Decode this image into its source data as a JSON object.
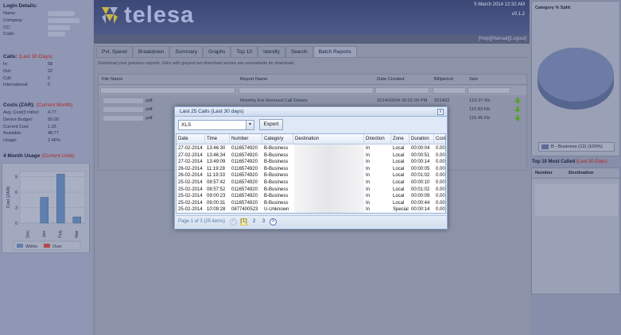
{
  "header": {
    "logo_text": "telesa",
    "date": "5 March 2014 12:32 AM",
    "version": "v0.1.2",
    "help_link": "[Help]",
    "manual_link": "[Manual]",
    "logout_link": "[Logout]"
  },
  "login": {
    "title": "Login Details:",
    "rows": [
      {
        "label": "Name:"
      },
      {
        "label": "Company:"
      },
      {
        "label": "CC:"
      },
      {
        "label": "Code:"
      }
    ]
  },
  "calls": {
    "title": "Calls:",
    "period": "(Last 30 Days)",
    "rows": [
      {
        "label": "In:",
        "value": "58"
      },
      {
        "label": "Out:",
        "value": "22"
      },
      {
        "label": "Coll:",
        "value": "0"
      },
      {
        "label": "International:",
        "value": "0"
      }
    ]
  },
  "costs": {
    "title": "Costs (ZAR):",
    "period": "(Current Month)",
    "rows": [
      {
        "label": "Avg. Cost(3 mths):",
        "value": "4.77"
      },
      {
        "label": "Device Budget:",
        "value": "50.00"
      },
      {
        "label": "Current Cost:",
        "value": "1.23"
      },
      {
        "label": "Available:",
        "value": "48.77"
      },
      {
        "label": "Usage:",
        "value": "2.46%"
      }
    ]
  },
  "usage_chart": {
    "title": "4 Month Usage",
    "title_note": "(Current Limit)",
    "legend_within": "Within",
    "legend_over": "Over",
    "colors": {
      "within": "#5f7fae",
      "over": "#b54a4a"
    }
  },
  "chart_data": {
    "type": "bar",
    "categories": [
      "Dec",
      "Jan",
      "Feb",
      "Mar"
    ],
    "values": [
      0,
      5,
      9.5,
      1.2
    ],
    "ylabel": "Cost (ZAR)",
    "yticks": [
      0,
      3,
      6,
      9
    ],
    "ylim": [
      0,
      10
    ],
    "legend": [
      "Within",
      "Over"
    ]
  },
  "tabs": [
    {
      "label": "Pvt. Spend"
    },
    {
      "label": "Breakdown"
    },
    {
      "label": "Summary"
    },
    {
      "label": "Graphs"
    },
    {
      "label": "Top 10"
    },
    {
      "label": "Identify"
    },
    {
      "label": "Search"
    },
    {
      "label": "Batch Reports",
      "active": true
    }
  ],
  "batch": {
    "hint": "Download your previous reports. Files with greyed out download arrows are unavailable for download.",
    "columns": [
      "File Name",
      "Report Name",
      "Date Created",
      "Billperiod",
      "Size"
    ],
    "rows": [
      {
        "file": ".pdf",
        "report": "Monthly Ext Itemised Call Details",
        "date": "2014/03/04 05:02:00 PM",
        "billperiod": "201402",
        "size": "123.37 Kb"
      },
      {
        "file": ".pdf",
        "report": "",
        "date": "",
        "billperiod": "",
        "size": "115.83 Kb"
      },
      {
        "file": ".pdf",
        "report": "",
        "date": "",
        "billperiod": "",
        "size": "115.45 Kb"
      }
    ]
  },
  "category_split": {
    "title": "Category % Split:",
    "legend": "B - Business (12) (100%)",
    "color": "#5b6b95"
  },
  "top10": {
    "title": "Top 10 Most Called",
    "period": "(Last 30 Days)",
    "columns": [
      "Number",
      "Destination"
    ]
  },
  "modal": {
    "title": "Last 25 Calls (Last 30 days)",
    "close": "x",
    "format": "XLS",
    "export_label": "Export",
    "columns": [
      "Date",
      "Time",
      "Number",
      "Category",
      "Destination",
      "Direction",
      "Zone",
      "Duration",
      "Cost"
    ],
    "rows": [
      {
        "date": "27-02-2014",
        "time": "13:46:30",
        "number": "0116574920",
        "category": "B-Business",
        "direction": "In",
        "zone": "Local",
        "duration": "00:00:04",
        "cost": "0.00"
      },
      {
        "date": "27-02-2014",
        "time": "13:46:34",
        "number": "0116574920",
        "category": "B-Business",
        "direction": "In",
        "zone": "Local",
        "duration": "00:00:51",
        "cost": "0.00"
      },
      {
        "date": "27-02-2014",
        "time": "13:49:09",
        "number": "0116574920",
        "category": "B-Business",
        "direction": "In",
        "zone": "Local",
        "duration": "00:00:14",
        "cost": "0.00"
      },
      {
        "date": "26-02-2014",
        "time": "11:19:28",
        "number": "0116574920",
        "category": "B-Business",
        "direction": "In",
        "zone": "Local",
        "duration": "00:00:05",
        "cost": "0.00"
      },
      {
        "date": "26-02-2014",
        "time": "11:19:33",
        "number": "0116574920",
        "category": "B-Business",
        "direction": "In",
        "zone": "Local",
        "duration": "00:01:02",
        "cost": "0.00"
      },
      {
        "date": "25-02-2014",
        "time": "08:57:42",
        "number": "0116574920",
        "category": "B-Business",
        "direction": "In",
        "zone": "Local",
        "duration": "00:00:10",
        "cost": "0.00"
      },
      {
        "date": "25-02-2014",
        "time": "08:57:52",
        "number": "0116574920",
        "category": "B-Business",
        "direction": "In",
        "zone": "Local",
        "duration": "00:01:02",
        "cost": "0.00"
      },
      {
        "date": "25-02-2014",
        "time": "09:00:23",
        "number": "0116574920",
        "category": "B-Business",
        "direction": "In",
        "zone": "Local",
        "duration": "00:00:09",
        "cost": "0.00"
      },
      {
        "date": "25-02-2014",
        "time": "09:00:31",
        "number": "0116574920",
        "category": "B-Business",
        "direction": "In",
        "zone": "Local",
        "duration": "00:00:44",
        "cost": "0.00"
      },
      {
        "date": "25-02-2014",
        "time": "10:09:28",
        "number": "0877400523",
        "category": "U-Unknown",
        "direction": "In",
        "zone": "Special",
        "duration": "00:00:14",
        "cost": "0.00"
      }
    ],
    "pager_info": "Page 1 of 3 (25 items)",
    "pager_prev": "<",
    "pages": [
      "[1]",
      "2",
      "3"
    ],
    "pager_next": ">"
  }
}
